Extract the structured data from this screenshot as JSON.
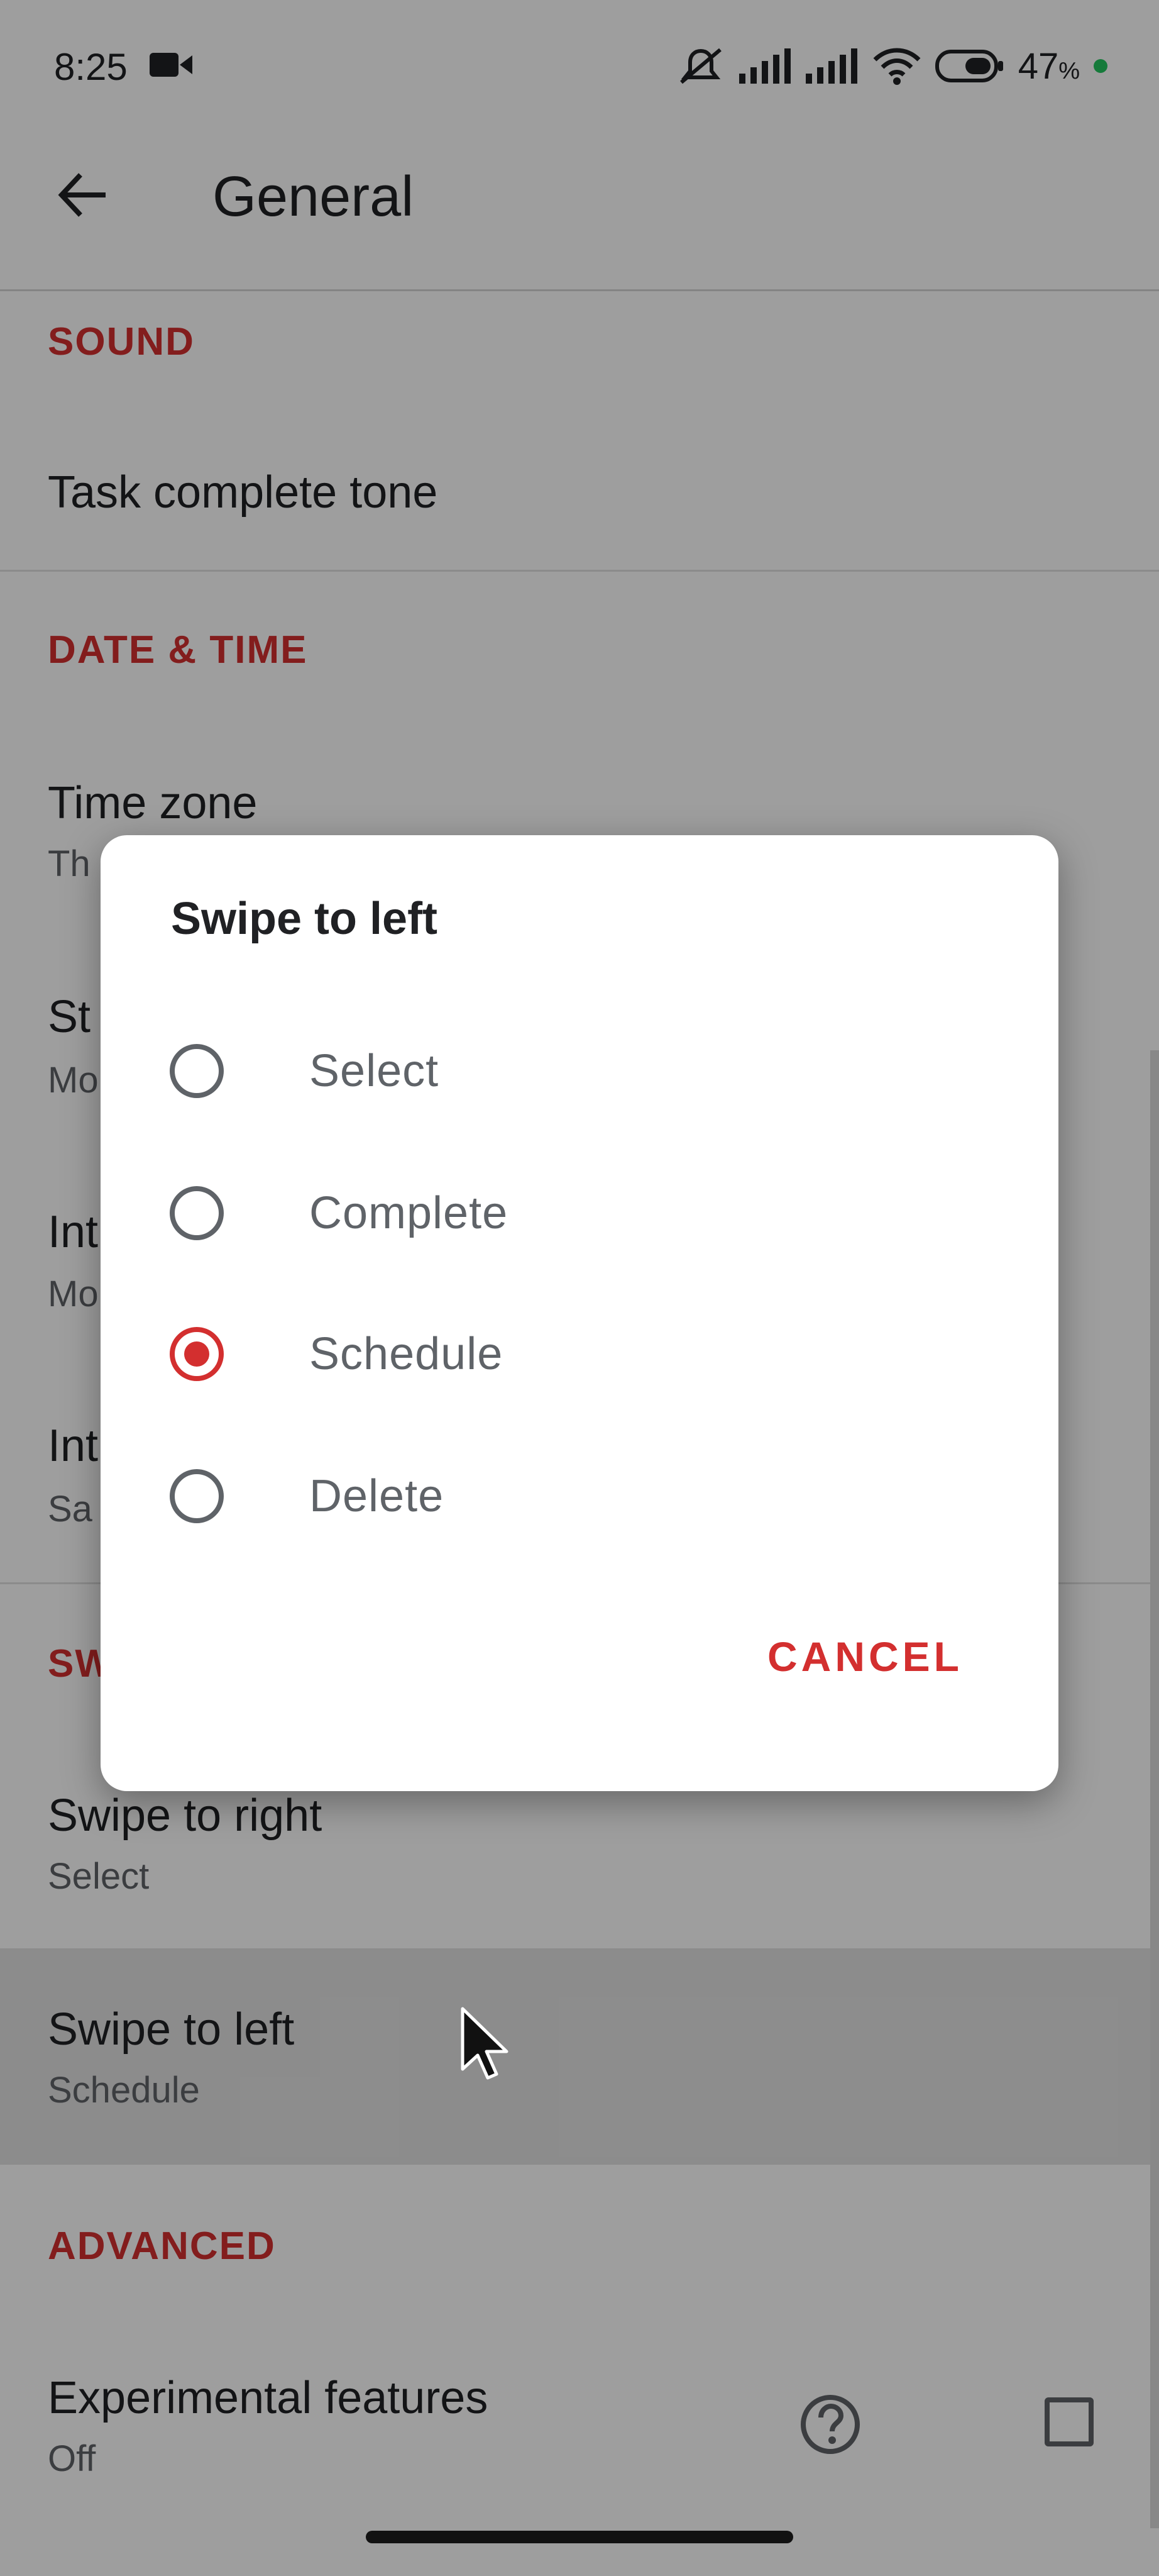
{
  "status_bar": {
    "time": "8:25",
    "battery_percent": "47",
    "battery_unit": "%",
    "icons": [
      "camera-icon",
      "mute-alarm-icon",
      "signal-1-icon",
      "signal-2-icon",
      "wifi-icon",
      "battery-icon"
    ]
  },
  "app_bar": {
    "back_icon": "arrow-left-icon",
    "title": "General"
  },
  "settings": {
    "sound_header": "SOUND",
    "task_complete_tone": "Task complete tone",
    "datetime_header": "DATE & TIME",
    "time_zone": {
      "title": "Time zone",
      "subtitle_partial": "Th"
    },
    "row_start": {
      "title_partial": "St",
      "subtitle_partial": "Mo"
    },
    "row_int1": {
      "title_partial": "Int",
      "subtitle_partial": "Mo"
    },
    "row_int2": {
      "title_partial": "Int",
      "subtitle_partial": "Sa"
    },
    "swipe_header_partial": "SW",
    "swipe_right": {
      "title": "Swipe to right",
      "subtitle": "Select"
    },
    "swipe_left": {
      "title": "Swipe to left",
      "subtitle": "Schedule"
    },
    "advanced_header": "ADVANCED",
    "experimental": {
      "title": "Experimental features",
      "subtitle": "Off",
      "help_icon": "help-circle-icon",
      "checked": false
    }
  },
  "dialog": {
    "title": "Swipe to left",
    "options": [
      {
        "label": "Select",
        "selected": false
      },
      {
        "label": "Complete",
        "selected": false
      },
      {
        "label": "Schedule",
        "selected": true
      },
      {
        "label": "Delete",
        "selected": false
      }
    ],
    "cancel_label": "CANCEL"
  },
  "colors": {
    "accent": "#d32f2f",
    "scrim": "rgba(0,0,0,0.38)",
    "battery_dot": "#22c55e"
  }
}
